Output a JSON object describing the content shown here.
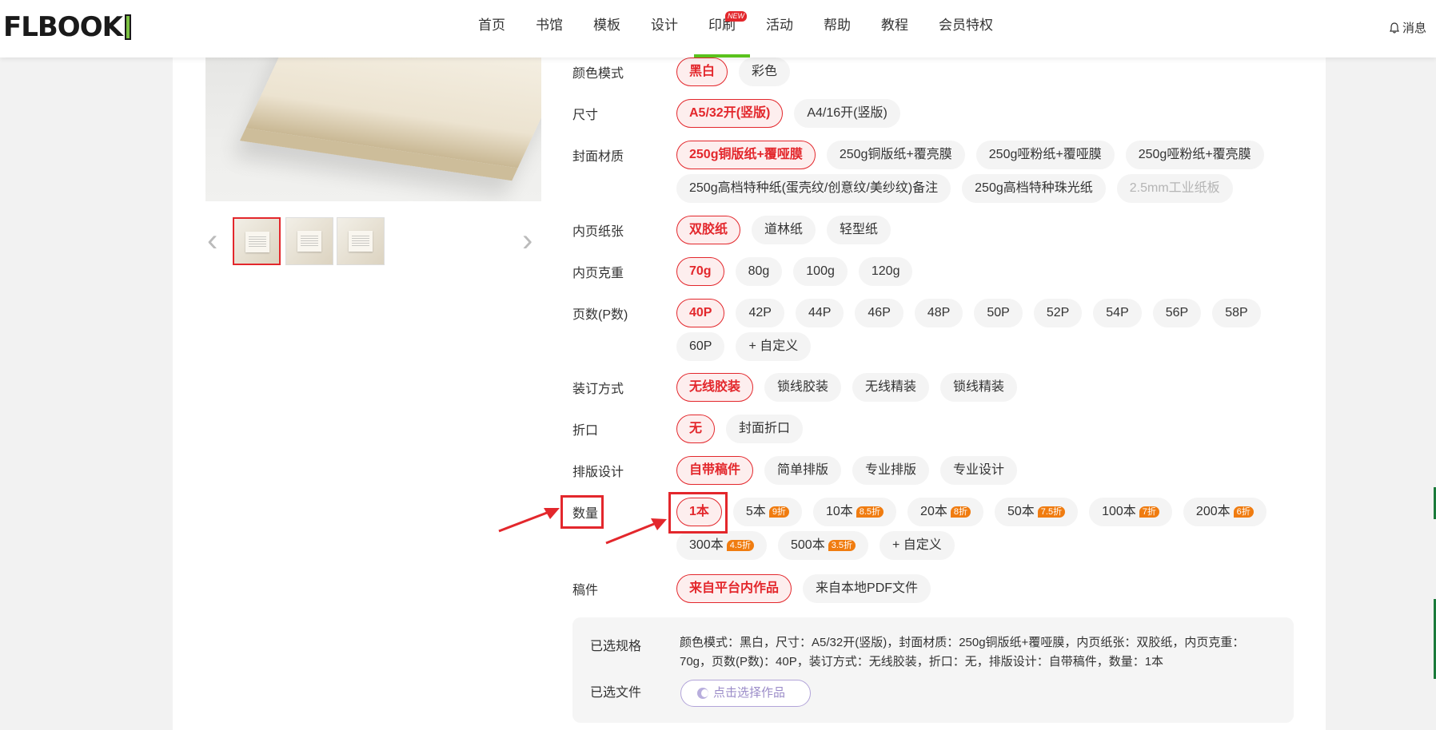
{
  "header": {
    "logo_text": "FLBOOK",
    "nav": [
      {
        "label": "首页"
      },
      {
        "label": "书馆"
      },
      {
        "label": "模板"
      },
      {
        "label": "设计"
      },
      {
        "label": "印刷",
        "badge": "NEW",
        "active": true
      },
      {
        "label": "活动"
      },
      {
        "label": "帮助"
      },
      {
        "label": "教程"
      },
      {
        "label": "会员特权"
      }
    ],
    "messages_label": "消息"
  },
  "gallery": {
    "prev_icon": "chevron-left-icon",
    "next_icon": "chevron-right-icon",
    "thumbnails": 3,
    "selected_index": 0
  },
  "options": [
    {
      "label": "颜色模式",
      "choices": [
        {
          "text": "黑白",
          "selected": true
        },
        {
          "text": "彩色"
        }
      ]
    },
    {
      "label": "尺寸",
      "choices": [
        {
          "text": "A5/32开(竖版)",
          "selected": true
        },
        {
          "text": "A4/16开(竖版)"
        }
      ]
    },
    {
      "label": "封面材质",
      "choices": [
        {
          "text": "250g铜版纸+覆哑膜",
          "selected": true
        },
        {
          "text": "250g铜版纸+覆亮膜"
        },
        {
          "text": "250g哑粉纸+覆哑膜"
        },
        {
          "text": "250g哑粉纸+覆亮膜"
        },
        {
          "text": "250g高档特种纸(蛋壳纹/创意纹/美纱纹)备注"
        },
        {
          "text": "250g高档特种珠光纸"
        },
        {
          "text": "2.5mm工业纸板",
          "disabled": true
        }
      ]
    },
    {
      "label": "内页纸张",
      "choices": [
        {
          "text": "双胶纸",
          "selected": true
        },
        {
          "text": "道林纸"
        },
        {
          "text": "轻型纸"
        }
      ]
    },
    {
      "label": "内页克重",
      "choices": [
        {
          "text": "70g",
          "selected": true
        },
        {
          "text": "80g"
        },
        {
          "text": "100g"
        },
        {
          "text": "120g"
        }
      ]
    },
    {
      "label": "页数(P数)",
      "choices": [
        {
          "text": "40P",
          "selected": true
        },
        {
          "text": "42P"
        },
        {
          "text": "44P"
        },
        {
          "text": "46P"
        },
        {
          "text": "48P"
        },
        {
          "text": "50P"
        },
        {
          "text": "52P"
        },
        {
          "text": "54P"
        },
        {
          "text": "56P"
        },
        {
          "text": "58P"
        },
        {
          "text": "60P"
        },
        {
          "text": "+ 自定义"
        }
      ]
    },
    {
      "label": "装订方式",
      "choices": [
        {
          "text": "无线胶装",
          "selected": true
        },
        {
          "text": "锁线胶装"
        },
        {
          "text": "无线精装"
        },
        {
          "text": "锁线精装"
        }
      ]
    },
    {
      "label": "折口",
      "choices": [
        {
          "text": "无",
          "selected": true
        },
        {
          "text": "封面折口"
        }
      ]
    },
    {
      "label": "排版设计",
      "choices": [
        {
          "text": "自带稿件",
          "selected": true
        },
        {
          "text": "简单排版"
        },
        {
          "text": "专业排版"
        },
        {
          "text": "专业设计"
        }
      ]
    },
    {
      "label": "数量",
      "choices": [
        {
          "text": "1本",
          "selected": true
        },
        {
          "text": "5本",
          "discount": "9折"
        },
        {
          "text": "10本",
          "discount": "8.5折"
        },
        {
          "text": "20本",
          "discount": "8折"
        },
        {
          "text": "50本",
          "discount": "7.5折"
        },
        {
          "text": "100本",
          "discount": "7折"
        },
        {
          "text": "200本",
          "discount": "6折"
        },
        {
          "text": "300本",
          "discount": "4.5折"
        },
        {
          "text": "500本",
          "discount": "3.5折"
        },
        {
          "text": "+ 自定义"
        }
      ]
    },
    {
      "label": "稿件",
      "choices": [
        {
          "text": "来自平台内作品",
          "selected": true
        },
        {
          "text": "来自本地PDF文件"
        }
      ]
    }
  ],
  "summary": {
    "spec_label": "已选规格",
    "spec_text": "颜色模式：黑白，尺寸：A5/32开(竖版)，封面材质：250g铜版纸+覆哑膜，内页纸张：双胶纸，内页克重：70g，页数(P数)：40P，装订方式：无线胶装，折口：无，排版设计：自带稿件，数量：1本",
    "file_label": "已选文件",
    "pick_button": "点击选择作品"
  },
  "colors": {
    "accent": "#e3272c",
    "nav_active": "#5ac21d",
    "discount": "#f07c10"
  }
}
